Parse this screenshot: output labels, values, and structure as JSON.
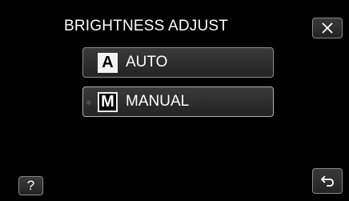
{
  "header": {
    "title": "BRIGHTNESS ADJUST"
  },
  "options": [
    {
      "letter": "A",
      "label": "AUTO"
    },
    {
      "letter": "M",
      "label": "MANUAL"
    }
  ],
  "help": {
    "label": "?"
  },
  "icons": {
    "close": "close-icon",
    "back": "back-icon"
  },
  "colors": {
    "background": "#000000",
    "button": "#2e2e2e",
    "text": "#ffffff"
  }
}
